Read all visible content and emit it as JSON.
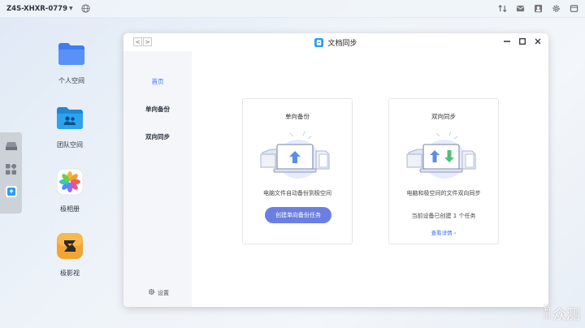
{
  "topbar": {
    "device_name": "Z4S-XHXR-0779",
    "icons": [
      "sort-icon",
      "message-icon",
      "user-icon",
      "gear-icon",
      "window-icon"
    ]
  },
  "desktop": {
    "icons": [
      {
        "label": "个人空间",
        "icon": "folder-icon"
      },
      {
        "label": "团队空间",
        "icon": "team-folder-icon"
      },
      {
        "label": "极相册",
        "icon": "photos-icon"
      },
      {
        "label": "极影视",
        "icon": "video-icon"
      }
    ]
  },
  "window": {
    "title": "文档同步",
    "sidebar": {
      "items": [
        {
          "label": "首页",
          "active": true
        },
        {
          "label": "单向备份",
          "active": false
        },
        {
          "label": "双向同步",
          "active": false
        }
      ],
      "settings_label": "设置"
    },
    "cards": [
      {
        "title": "单向备份",
        "description": "电脑文件自动备份到极空间",
        "button_label": "创建单向备份任务"
      },
      {
        "title": "双向同步",
        "description": "电脑和极空间的文件双向同步",
        "status": "当前设备已创建 1 个任务",
        "link_label": "查看详情"
      }
    ]
  },
  "watermark": {
    "small_top": "新",
    "small_bottom": "浪",
    "text": "众测"
  },
  "colors": {
    "accent": "#3b6ff5",
    "button": "#6b7fe3",
    "sidebar_bg": "#f4f6f9"
  }
}
